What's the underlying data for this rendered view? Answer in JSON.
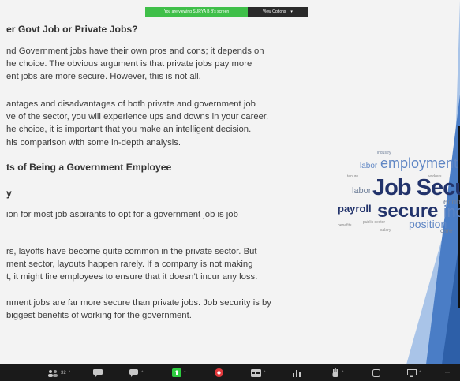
{
  "share_banner": {
    "message": "You are viewing SURYA B B's screen",
    "view_options_label": "View Options",
    "caret": "▾"
  },
  "document": {
    "title": "er Govt Job or Private Jobs?",
    "intro_lines": [
      "nd Government jobs have their own pros and cons; it depends on",
      "he choice. The obvious argument is that private jobs pay more",
      "ent jobs are more secure. However, this is not all."
    ],
    "para2_lines": [
      "antages and disadvantages of both private and government job",
      "ve of the sector, you will experience ups and downs in your career.",
      "he choice, it is important that you make an intelligent decision.",
      "his comparison with some in-depth analysis."
    ],
    "section_heading": "ts of Being a Government Employee",
    "sub_heading": "y",
    "para3_lines": [
      "ion for most job aspirants to opt for a government job is job"
    ],
    "para4_lines": [
      "rs, layoffs have become quite common in the private sector. But",
      "ment sector, layouts happen rarely. If a company is not making",
      "t, it might fire employees to ensure that it doesn’t incur any loss."
    ],
    "para5_lines": [
      "nment jobs are far more secure than private jobs. Job security is by",
      " biggest benefits of working for the government."
    ]
  },
  "wordcloud": {
    "employment": "employment",
    "labor_small": "labor",
    "job_secu": "Job Secu",
    "labor": "labor",
    "payroll": "payroll",
    "secure": "secure",
    "inc": "inc",
    "position": "position",
    "econ": "econ",
    "care": "care",
    "industry": "industry",
    "public_sector": "public sector",
    "benefits": "benefits",
    "tenure": "tenure",
    "salary": "salary",
    "workers": "workers"
  },
  "toolbar": {
    "participants_count": "32",
    "more_dots": "···"
  },
  "colors": {
    "banner_green": "#3fbf49",
    "banner_dark": "#2a2a2a",
    "toolbar_bg": "#1a1a1a",
    "wordcloud_navy": "#22336b",
    "wordcloud_blue": "#5f86c4",
    "accent_green": "#2ecc40",
    "record_red": "#e0393c",
    "side_blue": "#4a7dc6"
  }
}
